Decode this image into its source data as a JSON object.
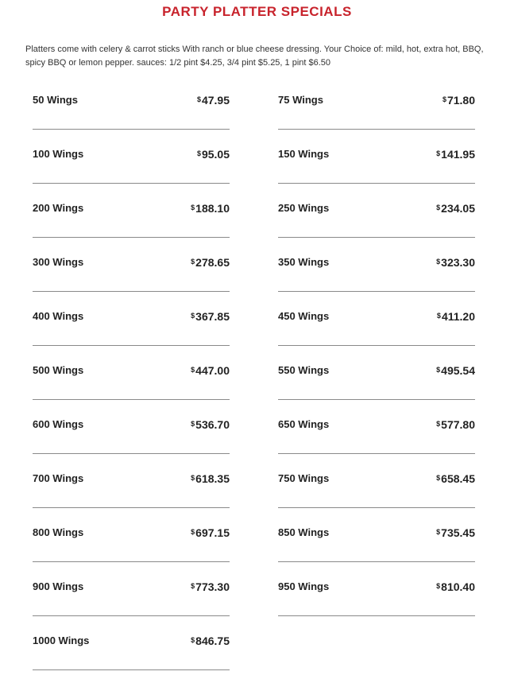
{
  "page": {
    "title": "PARTY PLATTER SPECIALS",
    "description": "Platters come with celery & carrot sticks With ranch or blue cheese dressing. Your Choice of: mild, hot, extra hot, BBQ, spicy BBQ or lemon pepper. sauces: 1/2 pint $4.25, 3/4 pint $5.25, 1 pint $6.50"
  },
  "menu": {
    "currency_symbol": "$",
    "items": [
      {
        "name": "50 Wings",
        "price": "47.95"
      },
      {
        "name": "75 Wings",
        "price": "71.80"
      },
      {
        "name": "100 Wings",
        "price": "95.05"
      },
      {
        "name": "150 Wings",
        "price": "141.95"
      },
      {
        "name": "200 Wings",
        "price": "188.10"
      },
      {
        "name": "250 Wings",
        "price": "234.05"
      },
      {
        "name": "300 Wings",
        "price": "278.65"
      },
      {
        "name": "350 Wings",
        "price": "323.30"
      },
      {
        "name": "400 Wings",
        "price": "367.85"
      },
      {
        "name": "450 Wings",
        "price": "411.20"
      },
      {
        "name": "500 Wings",
        "price": "447.00"
      },
      {
        "name": "550 Wings",
        "price": "495.54"
      },
      {
        "name": "600 Wings",
        "price": "536.70"
      },
      {
        "name": "650 Wings",
        "price": "577.80"
      },
      {
        "name": "700 Wings",
        "price": "618.35"
      },
      {
        "name": "750 Wings",
        "price": "658.45"
      },
      {
        "name": "800 Wings",
        "price": "697.15"
      },
      {
        "name": "850 Wings",
        "price": "735.45"
      },
      {
        "name": "900 Wings",
        "price": "773.30"
      },
      {
        "name": "950 Wings",
        "price": "810.40"
      },
      {
        "name": "1000 Wings",
        "price": "846.75"
      }
    ]
  },
  "colors": {
    "title": "#c8232c",
    "text": "#222222",
    "divider": "#8a8a8a"
  }
}
